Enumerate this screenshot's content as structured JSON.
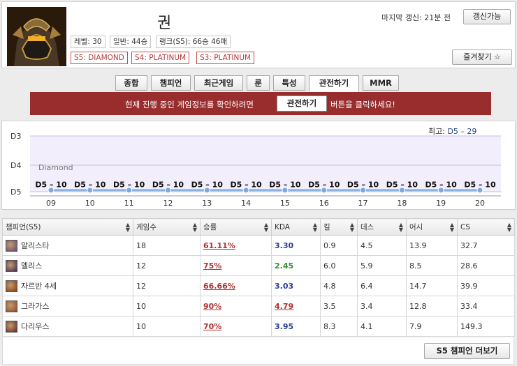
{
  "profile": {
    "name": "권",
    "stats": {
      "level": "레벨: 30",
      "normal": "일반: 44승",
      "ranked": "랭크(S5): 66승 46패"
    },
    "tiers": [
      "S5: DIAMOND",
      "S4: PLATINUM",
      "S3: PLATINUM"
    ],
    "last_update": "마지막 갱신: 21분 전",
    "refresh_label": "갱신가능",
    "favorite_label": "즐겨찾기 ☆"
  },
  "tabs": [
    "종합",
    "챔피언",
    "최근게임",
    "룬",
    "특성",
    "관전하기",
    "MMR"
  ],
  "active_tab": "관전하기",
  "notice": {
    "before": "현재 진행 중인 게임정보를 확인하려면",
    "button": "관전하기",
    "after": "버튼을 클릭하세요!"
  },
  "chart_data": {
    "type": "line",
    "best_label": "최고:",
    "best_value": "D5 – 29",
    "y_ticks": [
      "D3",
      "D4",
      "D5"
    ],
    "band_label": "Diamond",
    "categories": [
      "09",
      "10",
      "11",
      "12",
      "13",
      "14",
      "15",
      "16",
      "17",
      "18",
      "19",
      "20"
    ],
    "series": [
      {
        "values": [
          10,
          10,
          10,
          10,
          10,
          10,
          10,
          10,
          10,
          10,
          10,
          10
        ],
        "point_labels": [
          "D5 – 10",
          "D5 – 10",
          "D5 – 10",
          "D5 – 10",
          "D5 – 10",
          "D5 – 10",
          "D5 – 10",
          "D5 – 10",
          "D5 – 10",
          "D5 – 10",
          "D5 – 10",
          "D5 – 10"
        ]
      }
    ],
    "colors": {
      "band": "#f3eefb",
      "line": "#89b3e2",
      "point": "#7aa9de"
    }
  },
  "table": {
    "headers": [
      "챔피언(S5)",
      "게임수",
      "승률",
      "KDA",
      "킬",
      "데스",
      "어시",
      "CS"
    ],
    "rows": [
      {
        "icon": "alistar-icon",
        "icon_color": "#5a4a7a",
        "champion": "알리스타",
        "games": "18",
        "winrate": "61.11%",
        "kda": "3.30",
        "kda_style": "blue",
        "kills": "0.9",
        "deaths": "4.5",
        "assists": "13.9",
        "cs": "32.7"
      },
      {
        "icon": "elise-icon",
        "icon_color": "#3a2a5a",
        "champion": "엘리스",
        "games": "12",
        "winrate": "75%",
        "kda": "2.45",
        "kda_style": "green",
        "kills": "6.0",
        "deaths": "5.9",
        "assists": "8.5",
        "cs": "28.6"
      },
      {
        "icon": "xinzhao-icon",
        "icon_color": "#7a3a1a",
        "champion": "자르반 4세",
        "games": "12",
        "winrate": "66.66%",
        "kda": "3.03",
        "kda_style": "blue",
        "kills": "4.8",
        "deaths": "6.4",
        "assists": "14.7",
        "cs": "39.9"
      },
      {
        "icon": "gragas-icon",
        "icon_color": "#8a4a2a",
        "champion": "그라가스",
        "games": "10",
        "winrate": "90%",
        "kda": "4.79",
        "kda_style": "red",
        "kills": "3.5",
        "deaths": "3.4",
        "assists": "12.8",
        "cs": "33.4"
      },
      {
        "icon": "darius-icon",
        "icon_color": "#5a2a2a",
        "champion": "다리우스",
        "games": "10",
        "winrate": "70%",
        "kda": "3.95",
        "kda_style": "blue",
        "kills": "8.3",
        "deaths": "4.1",
        "assists": "7.9",
        "cs": "149.3"
      }
    ],
    "more_label": "S5 챔피언 더보기"
  }
}
